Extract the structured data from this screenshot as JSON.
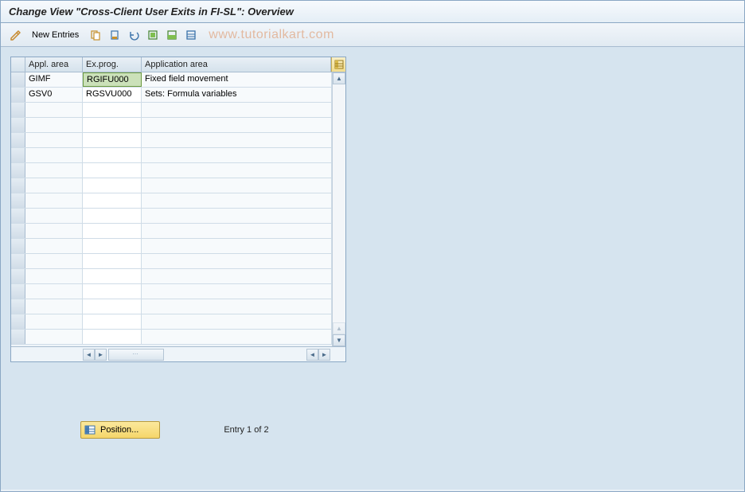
{
  "title": "Change View \"Cross-Client User Exits in FI-SL\": Overview",
  "toolbar": {
    "new_entries_label": "New Entries"
  },
  "watermark": "www.tutorialkart.com",
  "grid": {
    "headers": {
      "appl_area": "Appl. area",
      "ex_prog": "Ex.prog.",
      "application_area": "Application area"
    },
    "rows": [
      {
        "appl": "GIMF",
        "prog": "RGIFU000",
        "area": "Fixed field movement"
      },
      {
        "appl": "GSV0",
        "prog": "RGSVU000",
        "area": "Sets: Formula variables"
      }
    ],
    "empty_row_count": 16
  },
  "footer": {
    "position_label": "Position...",
    "entry_text": "Entry 1 of 2"
  }
}
